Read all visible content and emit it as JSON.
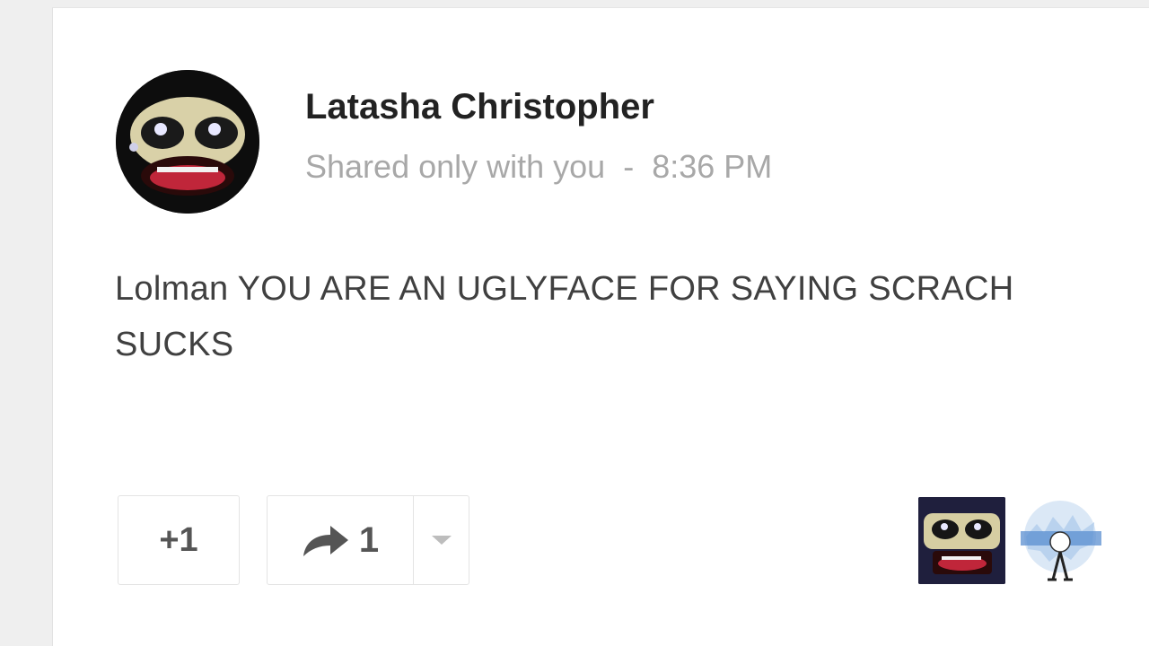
{
  "post": {
    "author": "Latasha Christopher",
    "visibility": "Shared only with you",
    "separator": "-",
    "time": "8:36 PM",
    "body": "Lolman YOU ARE AN UGLYFACE FOR SAYING SCRACH SUCKS"
  },
  "actions": {
    "plus_one_label": "+1",
    "share_count": "1"
  },
  "icons": {
    "share": "share-arrow-icon",
    "dropdown": "chevron-down-icon"
  },
  "colors": {
    "author": "#222222",
    "meta": "#a8a8a8",
    "body": "#404040",
    "button_text": "#555555"
  }
}
